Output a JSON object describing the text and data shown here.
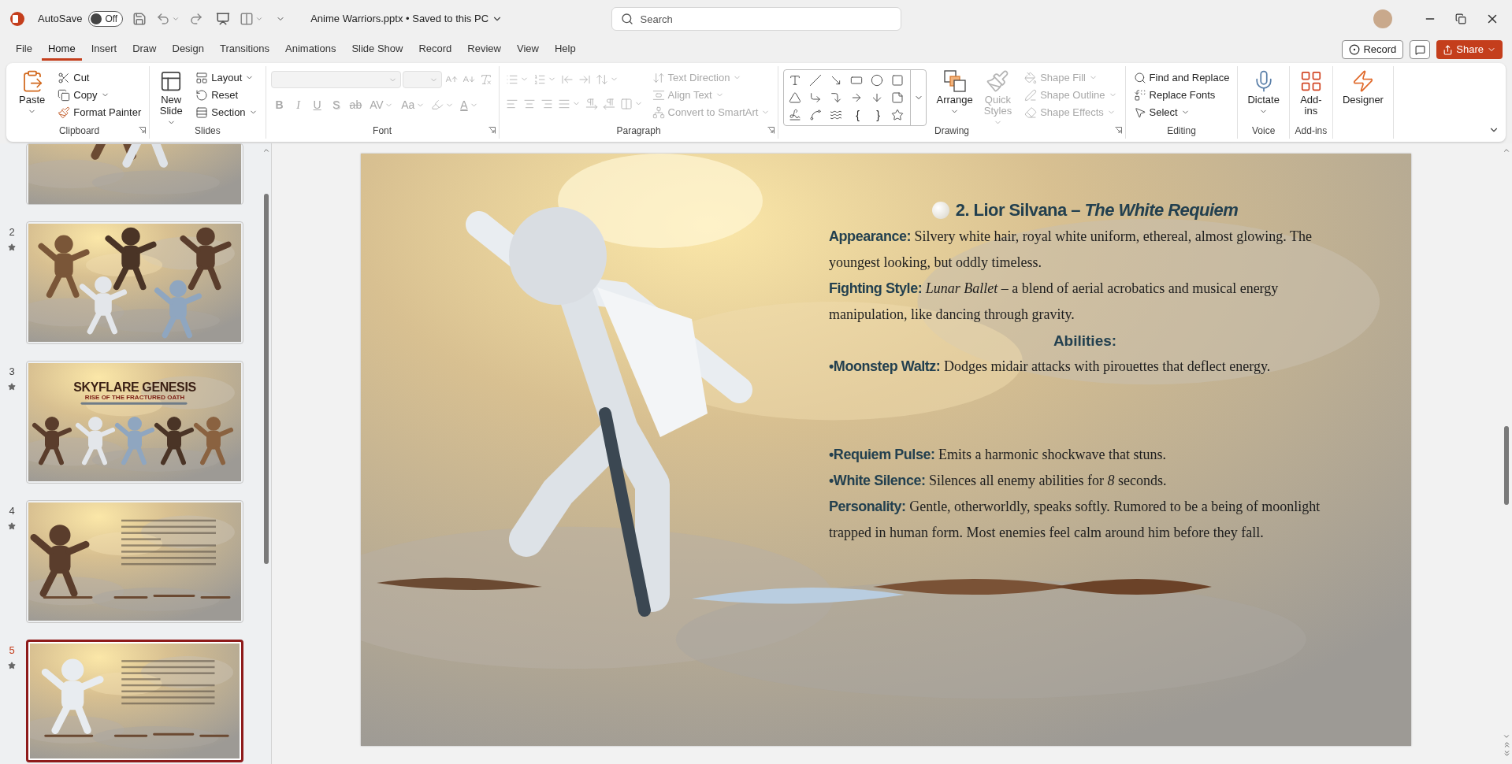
{
  "title_bar": {
    "autosave_label": "AutoSave",
    "autosave": {
      "on": false,
      "label": "Off"
    },
    "document": "Anime Warriors.pptx • Saved to this PC",
    "search": {
      "placeholder": "Search"
    }
  },
  "menu_tabs": [
    {
      "label": "File",
      "selected": false
    },
    {
      "label": "Home",
      "selected": true
    },
    {
      "label": "Insert",
      "selected": false
    },
    {
      "label": "Draw",
      "selected": false
    },
    {
      "label": "Design",
      "selected": false
    },
    {
      "label": "Transitions",
      "selected": false
    },
    {
      "label": "Animations",
      "selected": false
    },
    {
      "label": "Slide Show",
      "selected": false
    },
    {
      "label": "Record",
      "selected": false
    },
    {
      "label": "Review",
      "selected": false
    },
    {
      "label": "View",
      "selected": false
    },
    {
      "label": "Help",
      "selected": false
    }
  ],
  "header_actions": {
    "record": "Record",
    "share": "Share"
  },
  "ribbon": [
    {
      "label": "Clipboard",
      "launcher": true,
      "sections": [
        {
          "kind": "large",
          "items": [
            {
              "kind": "large",
              "label": "Paste",
              "dropdown": true,
              "disabled": false
            }
          ]
        },
        {
          "kind": "stack",
          "items": [
            {
              "kind": "small",
              "label": "Cut",
              "dropdown": false,
              "disabled": false
            },
            {
              "kind": "small",
              "label": "Copy",
              "dropdown": true,
              "disabled": false
            },
            {
              "kind": "small",
              "label": "Format Painter",
              "dropdown": false,
              "disabled": false
            }
          ]
        }
      ]
    },
    {
      "label": "Slides",
      "launcher": false,
      "sections": [
        {
          "kind": "large",
          "items": [
            {
              "kind": "large",
              "label": "New Slide",
              "dropdown": true,
              "disabled": false
            }
          ]
        },
        {
          "kind": "stack",
          "items": [
            {
              "kind": "small",
              "label": "Layout",
              "dropdown": true,
              "disabled": false
            },
            {
              "kind": "small",
              "label": "Reset",
              "dropdown": false,
              "disabled": false
            },
            {
              "kind": "small",
              "label": "Section",
              "dropdown": true,
              "disabled": false
            }
          ]
        }
      ]
    },
    {
      "label": "Font",
      "launcher": true,
      "sections": [
        {
          "kind": "rows",
          "rows": [
            {
              "items": [
                {
                  "kind": "combo",
                  "dropdown": true,
                  "disabled": true
                },
                {
                  "kind": "combo",
                  "dropdown": true,
                  "disabled": true
                },
                {
                  "kind": "icon",
                  "dropdown": false,
                  "disabled": true
                },
                {
                  "kind": "icon",
                  "dropdown": false,
                  "disabled": true
                },
                {
                  "kind": "icon",
                  "dropdown": false,
                  "disabled": true
                }
              ]
            },
            {
              "items": [
                {
                  "kind": "glyph",
                  "label": "B",
                  "dropdown": false,
                  "disabled": true
                },
                {
                  "kind": "glyph",
                  "label": "I",
                  "dropdown": false,
                  "disabled": true
                },
                {
                  "kind": "glyph",
                  "label": "U",
                  "dropdown": false,
                  "disabled": true
                },
                {
                  "kind": "glyph",
                  "label": "S",
                  "dropdown": false,
                  "disabled": true
                },
                {
                  "kind": "glyph",
                  "label": "ab",
                  "dropdown": false,
                  "disabled": true
                },
                {
                  "kind": "glyph",
                  "label": "AV",
                  "dropdown": true,
                  "disabled": true
                },
                {
                  "kind": "glyph",
                  "label": "Aa",
                  "dropdown": true,
                  "disabled": true
                },
                {
                  "kind": "icon",
                  "dropdown": true,
                  "disabled": true
                },
                {
                  "kind": "glyph",
                  "label": "A",
                  "dropdown": true,
                  "disabled": true
                }
              ]
            }
          ]
        }
      ]
    },
    {
      "label": "Paragraph",
      "launcher": true,
      "sections": [
        {
          "kind": "rows",
          "rows": [
            {
              "items": [
                {
                  "kind": "icon",
                  "dropdown": true,
                  "disabled": true
                },
                {
                  "kind": "icon",
                  "dropdown": true,
                  "disabled": true
                },
                {
                  "kind": "icon",
                  "dropdown": false,
                  "disabled": true
                },
                {
                  "kind": "icon",
                  "dropdown": false,
                  "disabled": true
                },
                {
                  "kind": "icon",
                  "dropdown": true,
                  "disabled": true
                }
              ]
            },
            {
              "items": [
                {
                  "kind": "icon",
                  "dropdown": false,
                  "disabled": true
                },
                {
                  "kind": "icon",
                  "dropdown": false,
                  "disabled": true
                },
                {
                  "kind": "icon",
                  "dropdown": false,
                  "disabled": true
                },
                {
                  "kind": "icon",
                  "dropdown": true,
                  "disabled": true
                },
                {
                  "kind": "icon",
                  "dropdown": false,
                  "disabled": true
                },
                {
                  "kind": "icon",
                  "dropdown": false,
                  "disabled": true
                },
                {
                  "kind": "icon",
                  "dropdown": true,
                  "disabled": true
                }
              ]
            }
          ]
        },
        {
          "kind": "stack",
          "items": [
            {
              "kind": "small",
              "label": "Text Direction",
              "dropdown": true,
              "disabled": true
            },
            {
              "kind": "small",
              "label": "Align Text",
              "dropdown": true,
              "disabled": true
            },
            {
              "kind": "small",
              "label": "Convert to SmartArt",
              "dropdown": true,
              "disabled": true
            }
          ]
        }
      ]
    },
    {
      "label": "Drawing",
      "launcher": true,
      "sections": [
        {
          "kind": "gallery",
          "items": [
            {
              "kind": "icon",
              "disabled": false
            },
            {
              "kind": "icon",
              "disabled": false
            },
            {
              "kind": "icon",
              "disabled": false
            },
            {
              "kind": "icon",
              "disabled": false
            },
            {
              "kind": "icon",
              "disabled": false
            },
            {
              "kind": "icon",
              "disabled": false
            },
            {
              "kind": "icon",
              "disabled": false
            },
            {
              "kind": "icon",
              "disabled": false
            },
            {
              "kind": "icon",
              "disabled": false
            },
            {
              "kind": "icon",
              "disabled": false
            },
            {
              "kind": "icon",
              "disabled": false
            },
            {
              "kind": "icon",
              "disabled": false
            },
            {
              "kind": "icon",
              "disabled": false
            },
            {
              "kind": "icon",
              "disabled": false
            },
            {
              "kind": "icon",
              "disabled": false
            },
            {
              "kind": "glyph",
              "label": "{",
              "disabled": false
            },
            {
              "kind": "glyph",
              "label": "}",
              "disabled": false
            },
            {
              "kind": "icon",
              "disabled": false
            }
          ]
        },
        {
          "kind": "large",
          "items": [
            {
              "kind": "large",
              "label": "Arrange",
              "dropdown": true,
              "disabled": false
            },
            {
              "kind": "large",
              "label": "Quick Styles",
              "dropdown": true,
              "disabled": true
            }
          ]
        },
        {
          "kind": "stack",
          "items": [
            {
              "kind": "small",
              "label": "Shape Fill",
              "dropdown": true,
              "disabled": true
            },
            {
              "kind": "small",
              "label": "Shape Outline",
              "dropdown": true,
              "disabled": true
            },
            {
              "kind": "small",
              "label": "Shape Effects",
              "dropdown": true,
              "disabled": true
            }
          ]
        }
      ]
    },
    {
      "label": "Editing",
      "launcher": false,
      "sections": [
        {
          "kind": "stack",
          "items": [
            {
              "kind": "small",
              "label": "Find and Replace",
              "dropdown": false,
              "disabled": false
            },
            {
              "kind": "small",
              "label": "Replace Fonts",
              "dropdown": false,
              "disabled": false
            },
            {
              "kind": "small",
              "label": "Select",
              "dropdown": true,
              "disabled": false
            }
          ]
        }
      ]
    },
    {
      "label": "Voice",
      "launcher": false,
      "sections": [
        {
          "kind": "large",
          "items": [
            {
              "kind": "large",
              "label": "Dictate",
              "dropdown": true,
              "disabled": false
            }
          ]
        }
      ]
    },
    {
      "label": "Add-ins",
      "launcher": false,
      "sections": [
        {
          "kind": "large",
          "items": [
            {
              "kind": "large",
              "label": "Add-ins",
              "dropdown": false,
              "disabled": false
            }
          ]
        }
      ]
    },
    {
      "launcher": false,
      "sections": [
        {
          "kind": "large",
          "items": [
            {
              "kind": "large",
              "label": "Designer",
              "dropdown": false,
              "disabled": false
            }
          ]
        }
      ]
    }
  ],
  "slides": [
    {
      "selected": false
    },
    {
      "number": "2",
      "selected": false
    },
    {
      "number": "3",
      "selected": false,
      "title": "SKYFLARE GENESIS",
      "subtitle": "RISE OF THE FRACTURED OATH"
    },
    {
      "number": "4",
      "selected": false
    },
    {
      "number": "5",
      "selected": true
    }
  ],
  "slide": {
    "heading": "2. Lior Silvana – *The White Requiem*",
    "blocks": [
      {
        "kind": "paragraph",
        "label": "Appearance:",
        "text": "Silvery white hair, royal white uniform, ethereal, almost glowing. The youngest looking, but oddly timeless."
      },
      {
        "kind": "paragraph",
        "label": "Fighting Style:",
        "text": "*Lunar Ballet* – a blend of aerial acrobatics and musical energy manipulation, like dancing through gravity."
      },
      {
        "kind": "heading",
        "text": "Abilities:"
      },
      {
        "kind": "paragraph",
        "label": "•Moonstep Waltz:",
        "text": "Dodges midair attacks with pirouettes that deflect energy."
      },
      {
        "kind": "paragraph",
        "label": "•Requiem Pulse:",
        "text": "Emits a harmonic shockwave that stuns."
      },
      {
        "kind": "paragraph",
        "label": "•White Silence:",
        "text": "Silences all enemy abilities for *8* seconds."
      },
      {
        "kind": "paragraph",
        "label": "Personality:",
        "text": "Gentle, otherworldly, speaks softly. Rumored to be a being of moonlight trapped in human form. Most enemies feel calm around him before they fall."
      }
    ]
  }
}
